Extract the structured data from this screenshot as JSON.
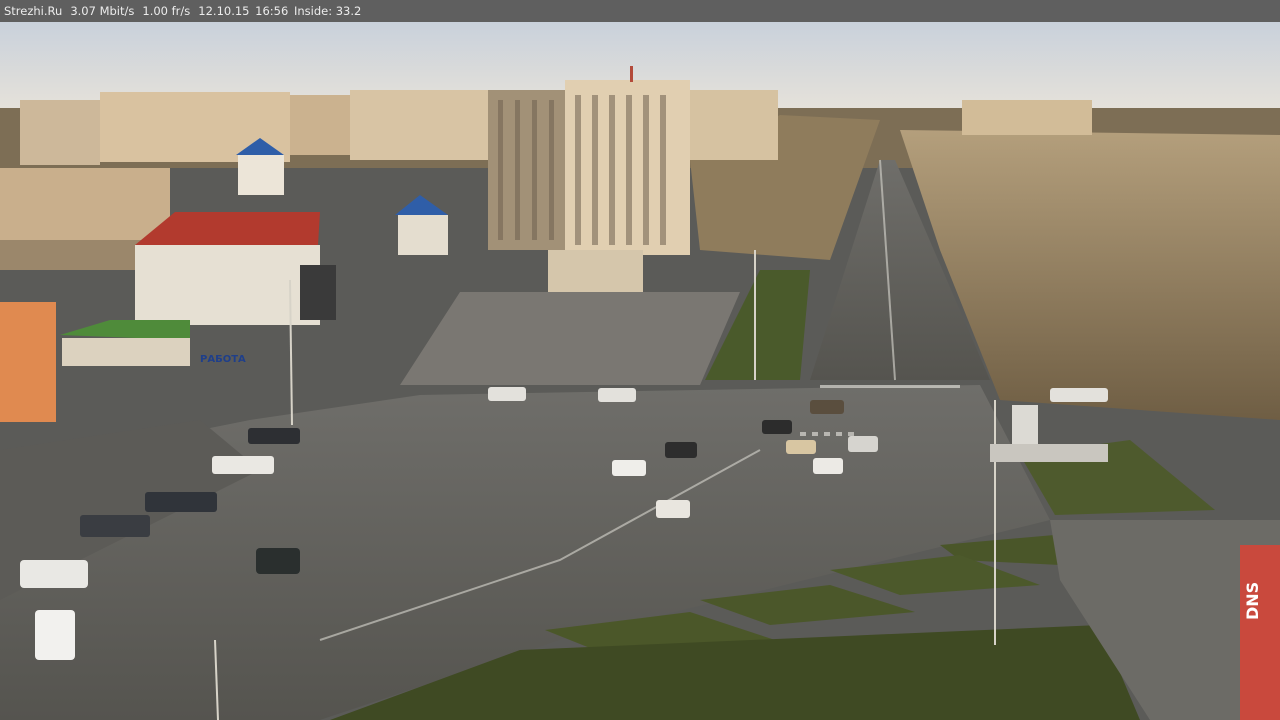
{
  "overlay": {
    "site": "Strezhi.Ru",
    "bitrate": "3.07 Mbit/s",
    "framerate": "1.00 fr/s",
    "date": "12.10.15",
    "time": "16:56",
    "inside": "Inside: 33.2"
  },
  "scene": {
    "billboard_text": "РАБОТА",
    "storefront_sign": "DNS",
    "colors": {
      "sky_top": "#cfd6de",
      "sky_horizon": "#e6e3dc",
      "asphalt": "#5d5c59",
      "asphalt_light": "#7b7a76",
      "grass": "#4b5a2c",
      "building_light": "#d9c6a8",
      "building_shadow": "#9b8a74",
      "red_roof": "#b23a2e",
      "blue_roof": "#2f5ea8",
      "trees": "#9a8562"
    }
  }
}
